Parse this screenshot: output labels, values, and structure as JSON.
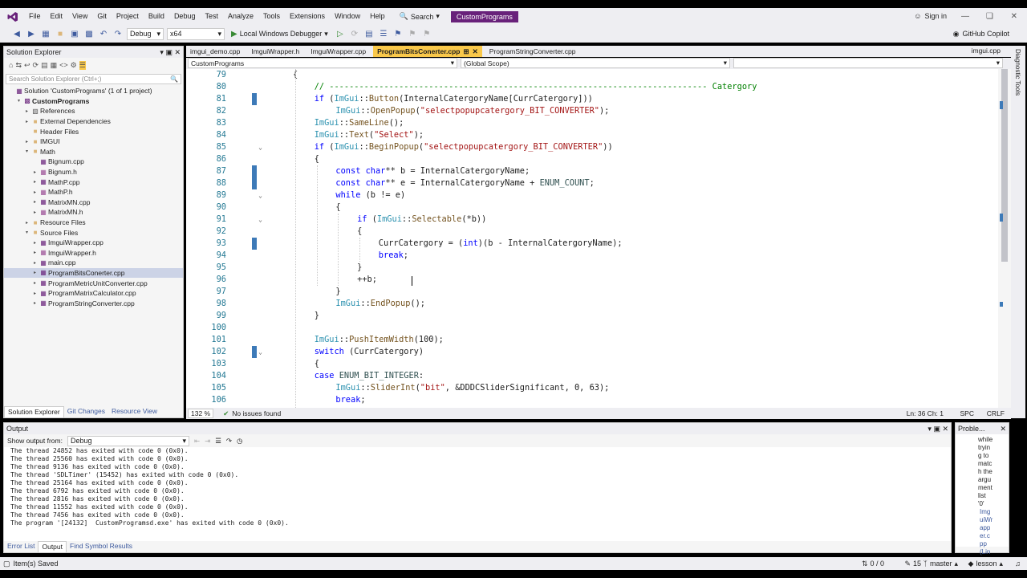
{
  "titlebar": {
    "menus": [
      "File",
      "Edit",
      "View",
      "Git",
      "Project",
      "Build",
      "Debug",
      "Test",
      "Analyze",
      "Tools",
      "Extensions",
      "Window",
      "Help"
    ],
    "search_label": "Search",
    "project_name": "CustomPrograms",
    "sign_in": "Sign in"
  },
  "toolbar": {
    "config": "Debug",
    "platform": "x64",
    "run_label": "Local Windows Debugger",
    "copilot": "GitHub Copilot"
  },
  "solution_explorer": {
    "title": "Solution Explorer",
    "search_placeholder": "Search Solution Explorer (Ctrl+;)",
    "items": [
      {
        "label": "Solution 'CustomPrograms' (1 of 1 project)",
        "indent": 0,
        "icon": "solution-icon",
        "exp": ""
      },
      {
        "label": "CustomPrograms",
        "indent": 1,
        "icon": "project-icon",
        "exp": "▾",
        "bold": true
      },
      {
        "label": "References",
        "indent": 2,
        "icon": "references-icon",
        "exp": "▸"
      },
      {
        "label": "External Dependencies",
        "indent": 2,
        "icon": "folder-icon",
        "exp": "▸"
      },
      {
        "label": "Header Files",
        "indent": 2,
        "icon": "folder-icon",
        "exp": ""
      },
      {
        "label": "IMGUI",
        "indent": 2,
        "icon": "folder-icon",
        "exp": "▸"
      },
      {
        "label": "Math",
        "indent": 2,
        "icon": "folder-icon",
        "exp": "▾"
      },
      {
        "label": "Bignum.cpp",
        "indent": 3,
        "icon": "cpp-file-icon",
        "exp": ""
      },
      {
        "label": "Bignum.h",
        "indent": 3,
        "icon": "h-file-icon",
        "exp": "▸"
      },
      {
        "label": "MathP.cpp",
        "indent": 3,
        "icon": "cpp-file-icon",
        "exp": "▸"
      },
      {
        "label": "MathP.h",
        "indent": 3,
        "icon": "h-file-icon",
        "exp": "▸"
      },
      {
        "label": "MatrixMN.cpp",
        "indent": 3,
        "icon": "cpp-file-icon",
        "exp": "▸"
      },
      {
        "label": "MatrixMN.h",
        "indent": 3,
        "icon": "h-file-icon",
        "exp": "▸"
      },
      {
        "label": "Resource Files",
        "indent": 2,
        "icon": "folder-icon",
        "exp": "▸"
      },
      {
        "label": "Source Files",
        "indent": 2,
        "icon": "folder-icon",
        "exp": "▾"
      },
      {
        "label": "ImguiWrapper.cpp",
        "indent": 3,
        "icon": "cpp-file-icon",
        "exp": "▸"
      },
      {
        "label": "ImguiWrapper.h",
        "indent": 3,
        "icon": "h-file-icon",
        "exp": "▸"
      },
      {
        "label": "main.cpp",
        "indent": 3,
        "icon": "cpp-file-icon",
        "exp": "▸"
      },
      {
        "label": "ProgramBitsConerter.cpp",
        "indent": 3,
        "icon": "cpp-file-icon",
        "exp": "▸",
        "selected": true
      },
      {
        "label": "ProgramMetricUnitConverter.cpp",
        "indent": 3,
        "icon": "cpp-file-icon",
        "exp": "▸"
      },
      {
        "label": "ProgramMatrixCalculator.cpp",
        "indent": 3,
        "icon": "cpp-file-icon",
        "exp": "▸"
      },
      {
        "label": "ProgramStringConverter.cpp",
        "indent": 3,
        "icon": "cpp-file-icon",
        "exp": "▸"
      }
    ],
    "bottom_tabs": [
      "Solution Explorer",
      "Git Changes",
      "Resource View"
    ]
  },
  "editor_tabs": {
    "left": [
      "imgui_demo.cpp",
      "ImguiWrapper.h",
      "ImguiWrapper.cpp",
      "ProgramBitsConerter.cpp",
      "ProgramStringConverter.cpp"
    ],
    "active_index": 3,
    "right": "imgui.cpp"
  },
  "navbar": {
    "project": "CustomPrograms",
    "scope": "(Global Scope)"
  },
  "code_lines": [
    {
      "n": "79",
      "html": "<span>{</span>",
      "indent": 0
    },
    {
      "n": "80",
      "html": "<span class='cm'>// ---------------------------------------------------------------------------- Catergory</span>",
      "indent": 1
    },
    {
      "n": "81",
      "html": "<span class='kw'>if</span> (<span class='ns'>ImGui</span>::<span class='fn'>Button</span>(InternalCatergoryName[CurrCatergory]))",
      "indent": 1,
      "chg": true
    },
    {
      "n": "82",
      "html": "<span class='ns'>ImGui</span>::<span class='fn'>OpenPopup</span>(<span class='str'>\"selectpopupcatergory_BIT_CONVERTER\"</span>);",
      "indent": 2
    },
    {
      "n": "83",
      "html": "<span class='ns'>ImGui</span>::<span class='fn'>SameLine</span>();",
      "indent": 1
    },
    {
      "n": "84",
      "html": "<span class='ns'>ImGui</span>::<span class='fn'>Text</span>(<span class='str'>\"Select\"</span>);",
      "indent": 1
    },
    {
      "n": "85",
      "html": "<span class='kw'>if</span> (<span class='ns'>ImGui</span>::<span class='fn'>BeginPopup</span>(<span class='str'>\"selectpopupcatergory_BIT_CONVERTER\"</span>))",
      "indent": 1,
      "fold": true
    },
    {
      "n": "86",
      "html": "{",
      "indent": 1
    },
    {
      "n": "87",
      "html": "<span class='kw'>const char</span>** b = InternalCatergoryName;",
      "indent": 2,
      "chg": true
    },
    {
      "n": "88",
      "html": "<span class='kw'>const char</span>** e = InternalCatergoryName + <span class='en'>ENUM_COUNT</span>;",
      "indent": 2,
      "chg": true
    },
    {
      "n": "89",
      "html": "<span class='kw'>while</span> (b != e)",
      "indent": 2,
      "fold": true
    },
    {
      "n": "90",
      "html": "{",
      "indent": 2
    },
    {
      "n": "91",
      "html": "<span class='kw'>if</span> (<span class='ns'>ImGui</span>::<span class='fn'>Selectable</span>(*b))",
      "indent": 3,
      "fold": true
    },
    {
      "n": "92",
      "html": "{",
      "indent": 3
    },
    {
      "n": "93",
      "html": "CurrCatergory = (<span class='kw'>int</span>)(b - InternalCatergoryName);",
      "indent": 4,
      "chg": true
    },
    {
      "n": "94",
      "html": "<span class='kw'>break</span>;",
      "indent": 4
    },
    {
      "n": "95",
      "html": "}",
      "indent": 3
    },
    {
      "n": "96",
      "html": "++b;",
      "indent": 3
    },
    {
      "n": "97",
      "html": "}",
      "indent": 2
    },
    {
      "n": "98",
      "html": "<span class='ns'>ImGui</span>::<span class='fn'>EndPopup</span>();",
      "indent": 2
    },
    {
      "n": "99",
      "html": "}",
      "indent": 1
    },
    {
      "n": "100",
      "html": "",
      "indent": 0
    },
    {
      "n": "101",
      "html": "<span class='ns'>ImGui</span>::<span class='fn'>PushItemWidth</span>(100);",
      "indent": 1
    },
    {
      "n": "102",
      "html": "<span class='kw'>switch</span> (CurrCatergory)",
      "indent": 1,
      "chg": true,
      "fold": true
    },
    {
      "n": "103",
      "html": "{",
      "indent": 1
    },
    {
      "n": "104",
      "html": "<span class='kw'>case</span> <span class='en'>ENUM_BIT_INTEGER</span>:",
      "indent": 1
    },
    {
      "n": "105",
      "html": "<span class='ns'>ImGui</span>::<span class='fn'>SliderInt</span>(<span class='str'>\"bit\"</span>, &amp;DDDCSliderSignificant, 0, 63);",
      "indent": 2
    },
    {
      "n": "106",
      "html": "<span class='kw'>break</span>;",
      "indent": 2
    }
  ],
  "editor_status": {
    "zoom": "132 %",
    "issues": "No issues found",
    "position": "Ln: 36   Ch: 1",
    "spc": "SPC",
    "eol": "CRLF"
  },
  "output": {
    "title": "Output",
    "show_from_label": "Show output from:",
    "show_from_value": "Debug",
    "lines": [
      "The thread 24852 has exited with code 0 (0x0).",
      "The thread 25560 has exited with code 0 (0x0).",
      "The thread 9136 has exited with code 0 (0x0).",
      "The thread 'SDLTimer' (15452) has exited with code 0 (0x0).",
      "The thread 25164 has exited with code 0 (0x0).",
      "The thread 6792 has exited with code 0 (0x0).",
      "The thread 2816 has exited with code 0 (0x0).",
      "The thread 11552 has exited with code 0 (0x0).",
      "The thread 7456 has exited with code 0 (0x0).",
      "The program '[24132]  CustomProgramsd.exe' has exited with code 0 (0x0)."
    ],
    "bottom_tabs": [
      "Error List",
      "Output",
      "Find Symbol Results"
    ]
  },
  "problems": {
    "title": "Proble...",
    "text_lines": [
      "while",
      "tryin",
      "g to",
      "matc",
      "h the",
      "argu",
      "ment",
      "list",
      "'0'"
    ],
    "link_lines": [
      "Img",
      "uiWr",
      "app",
      "er.c",
      "pp",
      "(Lin"
    ]
  },
  "statusbar": {
    "left": "Item(s) Saved",
    "errors": "0 / 0",
    "edits": "15",
    "branch": "master",
    "repo": "lesson"
  },
  "colors": {
    "accent": "#68217a",
    "active_tab": "#f9c84a",
    "change_marker": "#3d7ab8"
  }
}
